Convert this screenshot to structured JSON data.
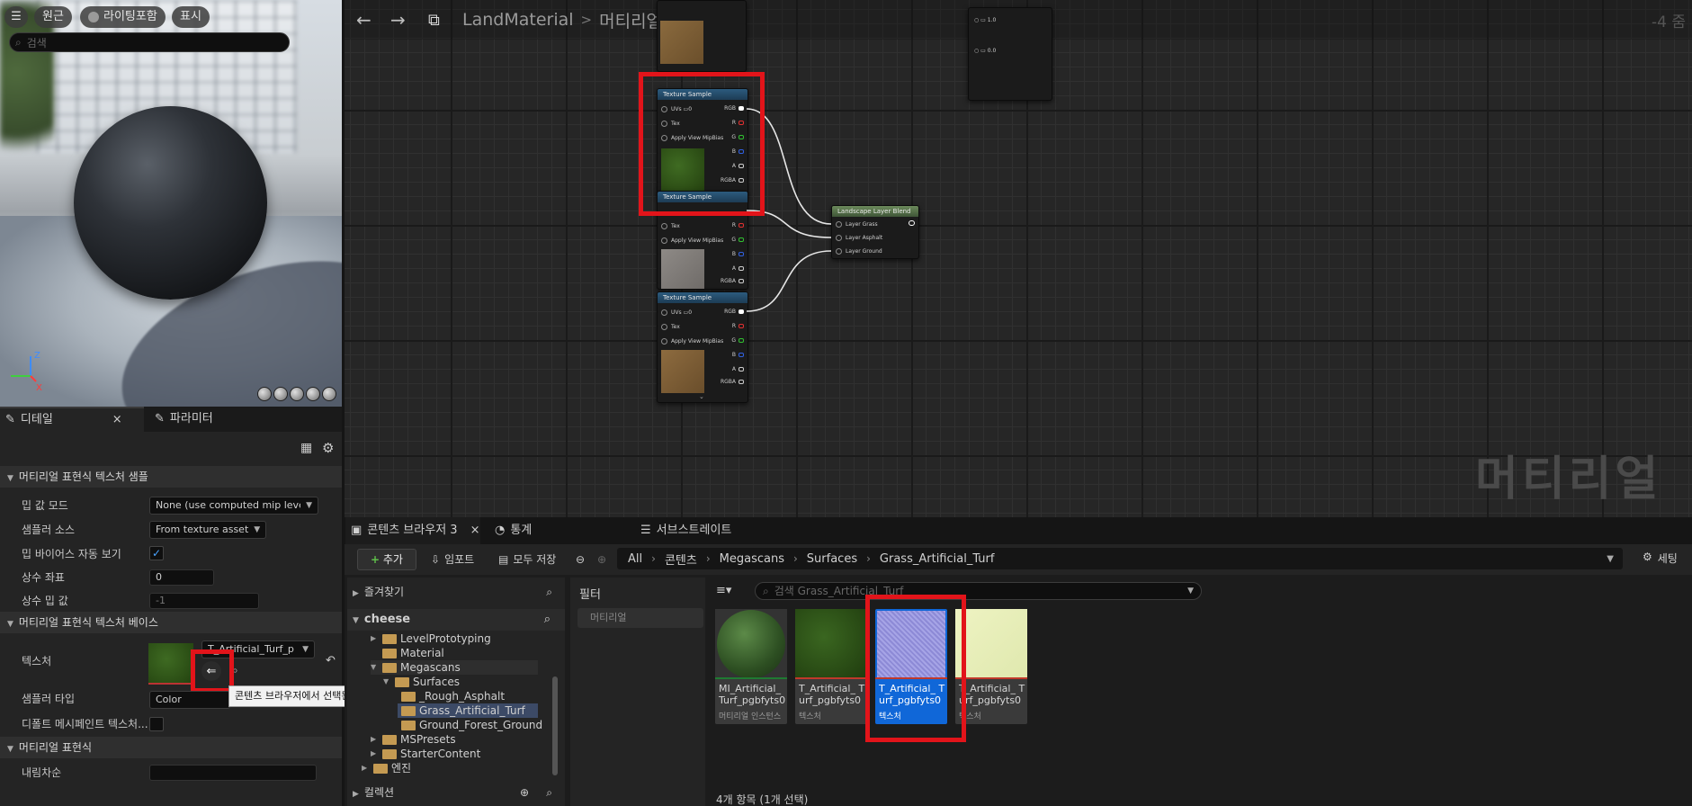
{
  "viewport": {
    "buttons": [
      "원근",
      "라이팅포함",
      "표시"
    ],
    "axis": {
      "z": "Z",
      "x": "X"
    }
  },
  "details": {
    "tab_details": "디테일",
    "tab_params": "파라미터",
    "search_placeholder": "검색",
    "section1": "머티리얼 표현식 텍스처 샘플",
    "mip_mode_label": "밉 값 모드",
    "mip_mode_value": "None (use computed mip level",
    "sampler_source_label": "샘플러 소스",
    "sampler_source_value": "From texture asset",
    "mip_bias_label": "밉 바이어스 자동 보기",
    "const_coord_label": "상수 좌표",
    "const_coord_value": "0",
    "const_mip_label": "상수 밉 값",
    "const_mip_value": "-1",
    "section2": "머티리얼 표현식 텍스처 베이스",
    "texture_label": "텍스처",
    "texture_value": "T_Artificial_Turf_p",
    "sampler_type_label": "샘플러 타입",
    "sampler_type_value": "Color",
    "default_mesh_label": "디폴트 메시페인트 텍스처...",
    "section3": "머티리얼 표현식",
    "desc_label": "내림차순",
    "tooltip": "콘텐츠 브라우저에서 선택된 에셋을 사용합니다."
  },
  "graph": {
    "crumb_root": "LandMaterial",
    "crumb_sep": ">",
    "crumb_leaf": "머티리얼 그래프",
    "zoom": "-4 줌",
    "watermark": "머티리얼",
    "node_title": "Texture Sample",
    "uvs_label": "UVs",
    "uvs_value": "0",
    "tex_label": "Tex",
    "apply_label": "Apply View MipBias",
    "out_rgb": "RGB",
    "out_r": "R",
    "out_g": "G",
    "out_b": "B",
    "out_a": "A",
    "out_rgba": "RGBA",
    "blend_title": "Landscape Layer Blend",
    "blend_layers": [
      "Layer Grass",
      "Layer Asphalt",
      "Layer Ground"
    ],
    "top_node_values": [
      "1.0",
      "0.0"
    ]
  },
  "content_browser": {
    "tab_cb": "콘텐츠 브라우저 3",
    "tab_stats": "통계",
    "tab_substrate": "서브스트레이트",
    "add": "추가",
    "import": "임포트",
    "save_all": "모두 저장",
    "path": [
      "All",
      "콘텐츠",
      "Megascans",
      "Surfaces",
      "Grass_Artificial_Turf"
    ],
    "settings": "세팅",
    "favorites": "즐겨찾기",
    "root": "cheese",
    "tree": [
      {
        "label": "LevelPrototyping",
        "depth": 1,
        "tri": "▶"
      },
      {
        "label": "Material",
        "depth": 1,
        "tri": ""
      },
      {
        "label": "Megascans",
        "depth": 1,
        "tri": "▼"
      },
      {
        "label": "Surfaces",
        "depth": 2,
        "tri": "▼"
      },
      {
        "label": "_Rough_Asphalt",
        "depth": 3,
        "tri": ""
      },
      {
        "label": "Grass_Artificial_Turf",
        "depth": 3,
        "tri": ""
      },
      {
        "label": "Ground_Forest_Ground",
        "depth": 3,
        "tri": ""
      },
      {
        "label": "MSPresets",
        "depth": 1,
        "tri": "▶"
      },
      {
        "label": "StarterContent",
        "depth": 1,
        "tri": "▶"
      },
      {
        "label": "엔진",
        "depth": 0,
        "tri": "▶"
      }
    ],
    "collections": "컬렉션",
    "filter_title": "필터",
    "filter_chip": "머티리얼",
    "search_placeholder": "검색 Grass_Artificial_Turf",
    "assets": [
      {
        "name": "MI_Artificial_ Turf_pgbfyts0",
        "type": "머티리얼 인스턴스"
      },
      {
        "name": "T_Artificial_ Turf_pgbfyts0",
        "type": "텍스처"
      },
      {
        "name": "T_Artificial_ Turf_pgbfyts0",
        "type": "텍스처"
      },
      {
        "name": "T_Artificial_ Turf_pgbfyts0",
        "type": "텍스처"
      }
    ],
    "status": "4개 항목 (1개 선택)"
  }
}
